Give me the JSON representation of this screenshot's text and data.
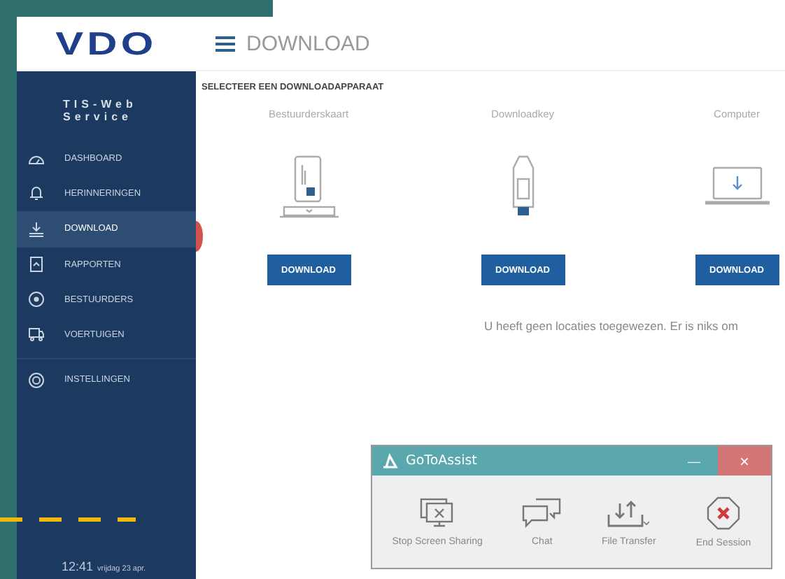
{
  "header": {
    "logo": "VDO",
    "title": "DOWNLOAD"
  },
  "sidebar": {
    "brand": "TIS-Web Service",
    "items": [
      {
        "kind": "dashboard",
        "label": "DASHBOARD",
        "selected": false
      },
      {
        "kind": "bell",
        "label": "HERINNERINGEN",
        "selected": false
      },
      {
        "kind": "download",
        "label": "DOWNLOAD",
        "selected": true
      },
      {
        "kind": "report",
        "label": "RAPPORTEN",
        "selected": false
      },
      {
        "kind": "driver",
        "label": "BESTUURDERS",
        "selected": false
      },
      {
        "kind": "truck",
        "label": "VOERTUIGEN",
        "selected": false
      },
      {
        "kind": "gear",
        "label": "INSTELLINGEN",
        "selected": false
      }
    ],
    "time": "12:41",
    "date": "vrijdag 23 apr."
  },
  "content": {
    "heading": "SELECTEER EEN DOWNLOADAPPARAAT",
    "devices": [
      {
        "kind": "card",
        "label": "Bestuurderskaart",
        "button": "DOWNLOAD"
      },
      {
        "kind": "key",
        "label": "Downloadkey",
        "button": "DOWNLOAD"
      },
      {
        "kind": "computer",
        "label": "Computer",
        "button": "DOWNLOAD"
      }
    ],
    "message": "U heeft geen locaties toegewezen. Er is niks om"
  },
  "assist": {
    "title": "GoToAssist",
    "minimize": "—",
    "close": "×",
    "actions": [
      {
        "kind": "screen",
        "label": "Stop Screen Sharing"
      },
      {
        "kind": "chat",
        "label": "Chat"
      },
      {
        "kind": "transfer",
        "label": "File Transfer"
      },
      {
        "kind": "end",
        "label": "End Session"
      }
    ]
  }
}
